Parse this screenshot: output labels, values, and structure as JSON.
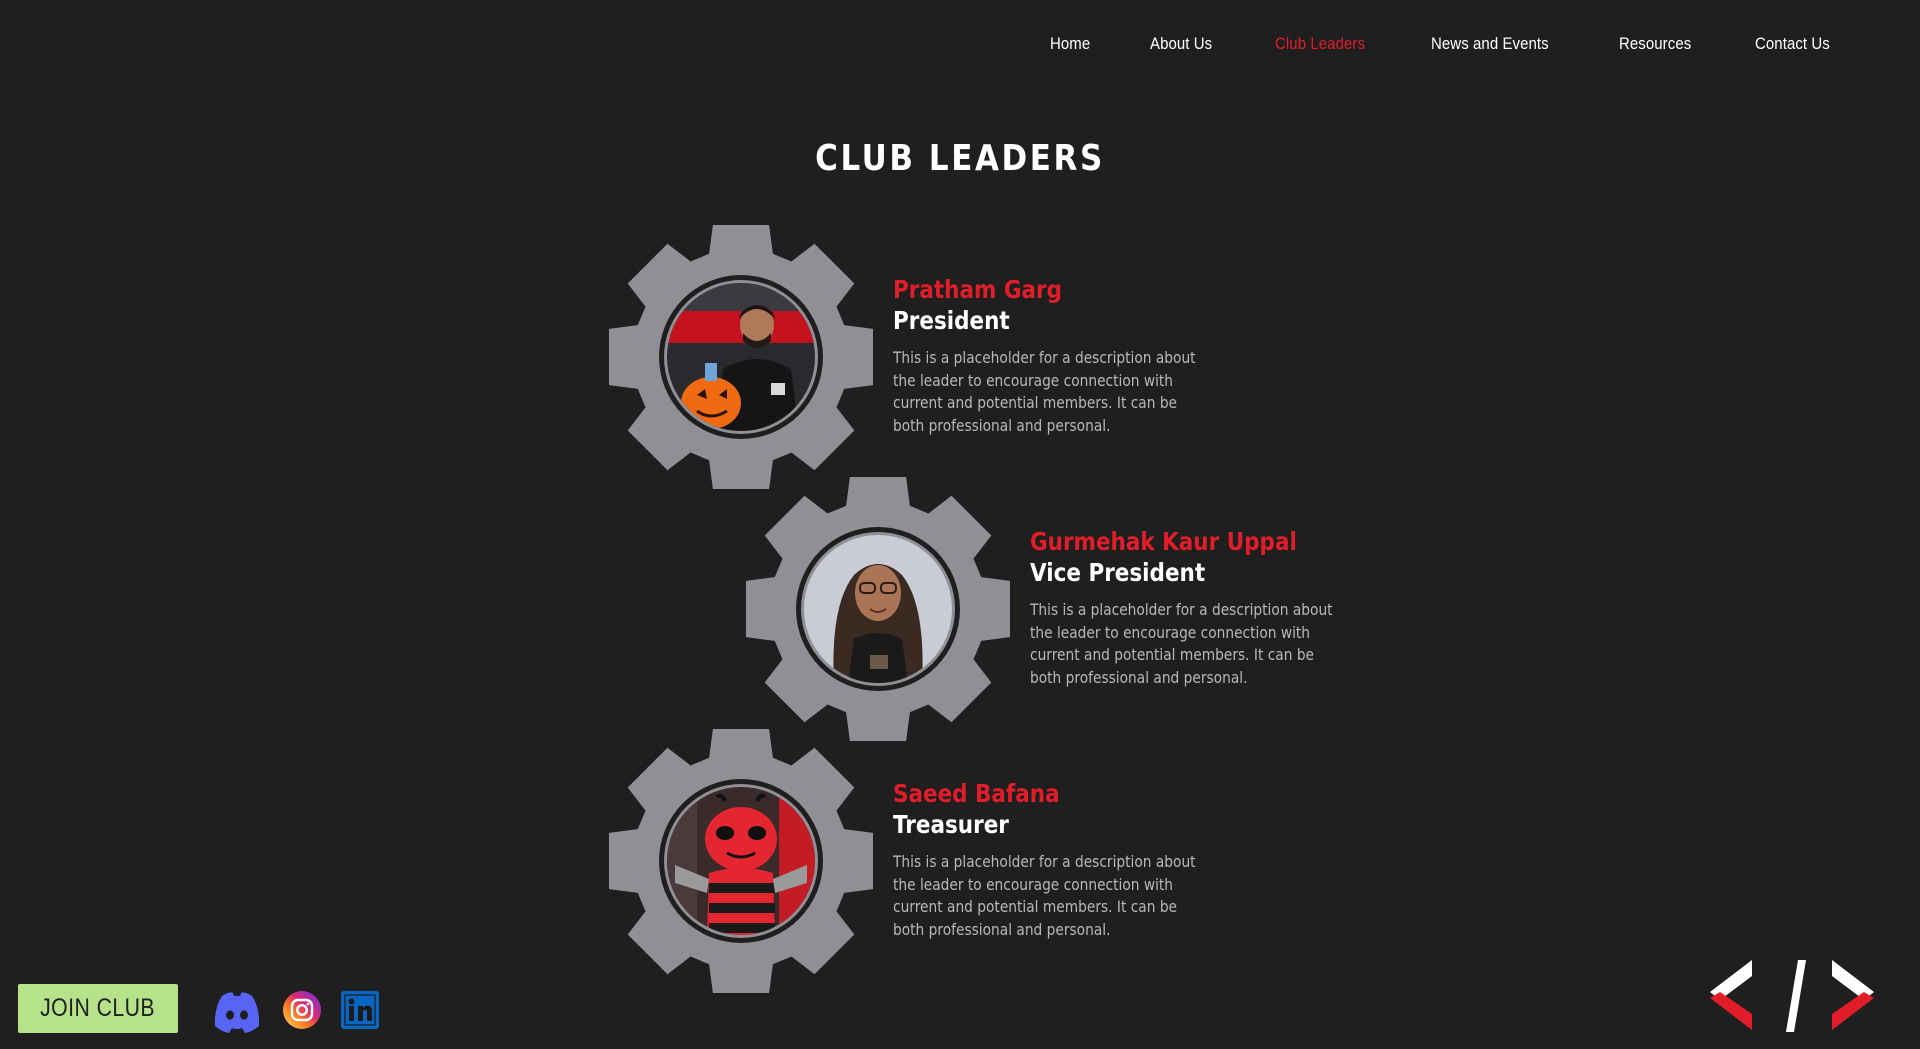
{
  "nav": {
    "items": [
      {
        "label": "Home",
        "active": false
      },
      {
        "label": "About Us",
        "active": false
      },
      {
        "label": "Club Leaders",
        "active": true
      },
      {
        "label": "News and Events",
        "active": false
      },
      {
        "label": "Resources",
        "active": false
      },
      {
        "label": "Contact Us",
        "active": false
      }
    ]
  },
  "page": {
    "title": "CLUB LEADERS"
  },
  "leaders": [
    {
      "name": "Pratham Garg",
      "role": "President",
      "description": "This is a placeholder for a description about the leader to encourage connection with current and potential members. It can be both professional and personal."
    },
    {
      "name": "Gurmehak Kaur Uppal",
      "role": "Vice President",
      "description": "This is a placeholder for a description about the leader to encourage connection with current and potential members. It can be both professional and personal."
    },
    {
      "name": "Saeed Bafana",
      "role": "Treasurer",
      "description": "This is a placeholder for a description about the leader to encourage connection with current and potential members. It can be both professional and personal."
    }
  ],
  "footer": {
    "join_label": "JOIN CLUB",
    "social": [
      {
        "icon": "discord-icon"
      },
      {
        "icon": "instagram-icon"
      },
      {
        "icon": "linkedin-icon"
      }
    ],
    "logo_icon": "code-brackets-logo"
  },
  "colors": {
    "background": "#1f1f1f",
    "accent_red": "#e11d2a",
    "gear_gray": "#8f9095",
    "join_green": "#b6e389",
    "text_muted": "#b9b9b9"
  }
}
